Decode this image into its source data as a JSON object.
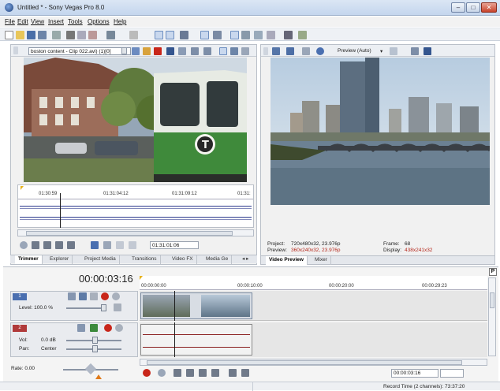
{
  "window": {
    "title": "Untitled * - Sony Vegas Pro 8.0",
    "min": "–",
    "max": "□",
    "close": "✕"
  },
  "menu": [
    {
      "label": "File"
    },
    {
      "label": "Edit"
    },
    {
      "label": "View"
    },
    {
      "label": "Insert"
    },
    {
      "label": "Tools"
    },
    {
      "label": "Options"
    },
    {
      "label": "Help"
    }
  ],
  "trimmer": {
    "clip_select": "boston content - Clip 022.avi) (1)[0]",
    "ruler_ticks": [
      "01:30:59",
      "01:31:04:12",
      "01:31:09:12",
      "01:31:"
    ],
    "timecode": "01:31:01:06",
    "tabs": [
      "Trimmer",
      "Explorer",
      "Project Media",
      "Transitions",
      "Video FX",
      "Media Ge"
    ]
  },
  "preview": {
    "mode": "Preview (Auto)",
    "project_label": "Project:",
    "project_value": "720x480x32, 23.976p",
    "preview_label": "Preview:",
    "preview_value": "360x240x32, 23.976p",
    "frame_label": "Frame:",
    "frame_value": "68",
    "display_label": "Display:",
    "display_value": "438x241x32",
    "tabs": [
      "Video Preview",
      "Mixer"
    ]
  },
  "timeline": {
    "cursor_time": "00:00:03:16",
    "ruler_ticks": [
      "00:00:00:00",
      "00:00:10:00",
      "00:00:20:00",
      "00:00:29:23"
    ],
    "video_track": {
      "number": "1",
      "level_label": "Level: 100.0 %"
    },
    "audio_track": {
      "number": "2",
      "vol_label": "Vol:",
      "vol_value": "0.0 dB",
      "pan_label": "Pan:",
      "pan_value": "Center"
    },
    "rate_label": "Rate: 0.00",
    "bottom_timecode": "00:00:03:16"
  },
  "status": {
    "record_time": "Record Time (2 channels): 73:37:20"
  },
  "colors": {
    "accent": "#2c5aa0",
    "video_track": "#4a6fb0",
    "audio_track": "#b03a3a",
    "waveform": "#2e3b8e",
    "playhead": "#1c1c1c"
  }
}
